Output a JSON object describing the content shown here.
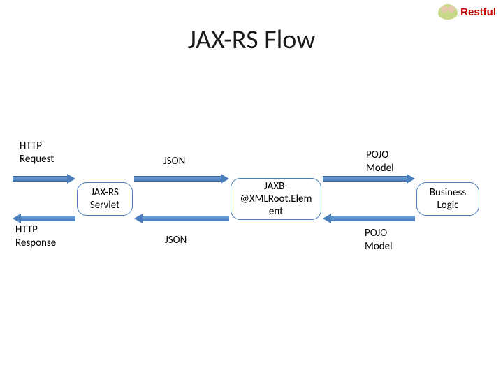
{
  "header": {
    "badge_label": "Restful"
  },
  "title": "JAX-RS Flow",
  "labels": {
    "http_request": "HTTP\nRequest",
    "http_response": "HTTP\nResponse",
    "json_top": "JSON",
    "json_bottom": "JSON",
    "pojo_top": "POJO\nModel",
    "pojo_bottom": "POJO\nModel"
  },
  "nodes": {
    "jaxrs_servlet": "JAX-RS\nServlet",
    "jaxb": "JAXB-\n@XMLRoot.Elem\nent",
    "business_logic": "Business\nLogic"
  }
}
